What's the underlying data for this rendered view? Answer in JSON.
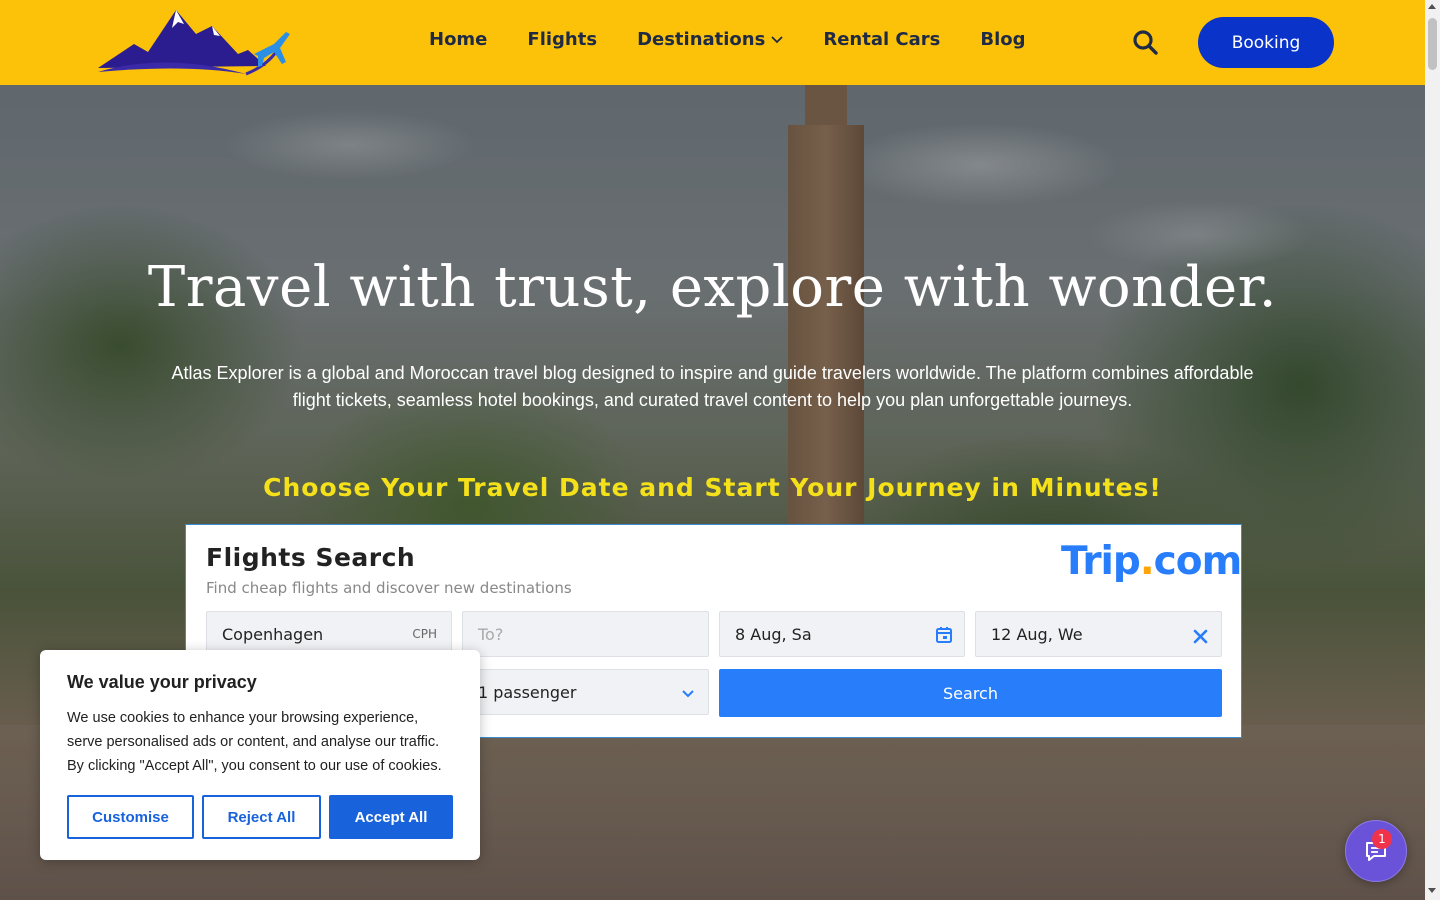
{
  "colors": {
    "header_bg": "#fcc20a",
    "booking_btn": "#0a34c9",
    "cta_text": "#f5e11a",
    "trip_blue": "#287dfa",
    "cookie_blue": "#1863dc",
    "chat_bg": "#6b53d9"
  },
  "header": {
    "logo_icon": "mountains-airplane-logo",
    "nav": [
      {
        "label": "Home"
      },
      {
        "label": "Flights"
      },
      {
        "label": "Destinations",
        "has_dropdown": true
      },
      {
        "label": "Rental Cars"
      },
      {
        "label": "Blog"
      }
    ],
    "search_icon": "search-icon",
    "booking_label": "Booking"
  },
  "hero": {
    "title": "Travel with trust, explore with wonder.",
    "description": "Atlas Explorer is a global and Moroccan travel blog designed to inspire and guide travelers worldwide. The platform combines affordable flight tickets, seamless hotel bookings, and curated travel content to help you plan unforgettable journeys.",
    "cta": "Choose Your Travel Date and Start Your Journey in Minutes!"
  },
  "flight_widget": {
    "title": "Flights Search",
    "subtitle": "Find cheap flights and discover new destinations",
    "brand": {
      "name": "Trip",
      "dot": ".",
      "tld": "com"
    },
    "from": {
      "value": "Copenhagen",
      "code": "CPH"
    },
    "to": {
      "placeholder": "To?"
    },
    "depart": {
      "value": "8 Aug, Sa",
      "icon": "calendar-icon"
    },
    "return": {
      "value": "12 Aug, We",
      "icon": "close-icon"
    },
    "passengers": {
      "value": "1 passenger",
      "icon": "chevron-down-icon"
    },
    "search_label": "Search"
  },
  "cookie": {
    "title": "We value your privacy",
    "text": "We use cookies to enhance your browsing experience, serve personalised ads or content, and analyse our traffic. By clicking \"Accept All\", you consent to our use of cookies.",
    "customise": "Customise",
    "reject": "Reject All",
    "accept": "Accept All"
  },
  "chat": {
    "icon": "chat-icon",
    "badge": "1"
  }
}
